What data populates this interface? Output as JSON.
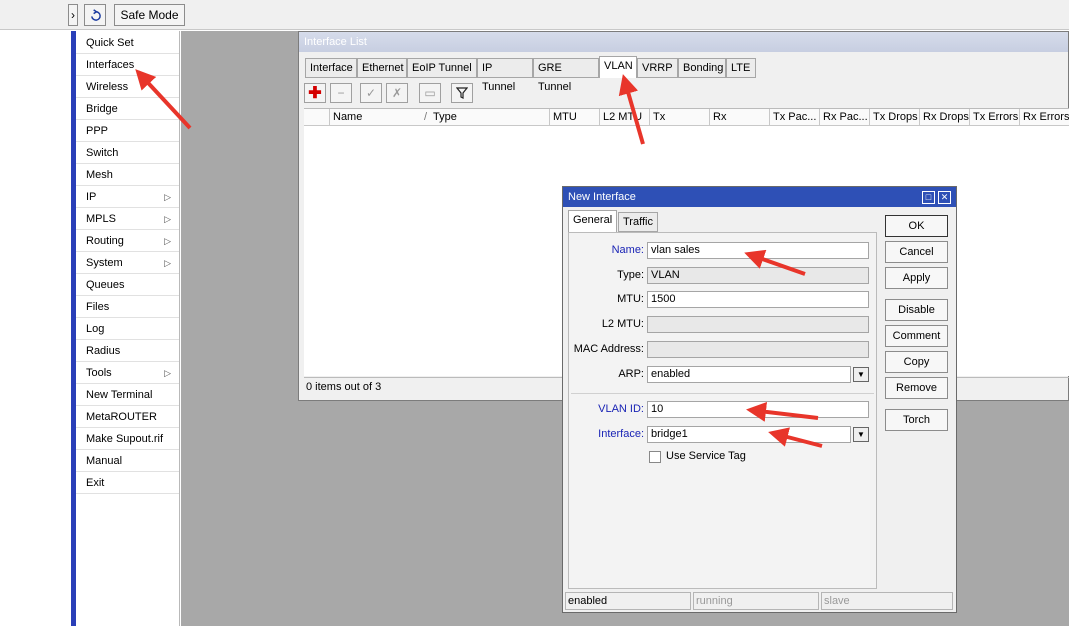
{
  "toolbar": {
    "redo_icon": "redo-icon",
    "safe_mode_label": "Safe Mode"
  },
  "sidebar": {
    "items": [
      {
        "label": "Quick Set",
        "submenu": false
      },
      {
        "label": "Interfaces",
        "submenu": false
      },
      {
        "label": "Wireless",
        "submenu": false
      },
      {
        "label": "Bridge",
        "submenu": false
      },
      {
        "label": "PPP",
        "submenu": false
      },
      {
        "label": "Switch",
        "submenu": false
      },
      {
        "label": "Mesh",
        "submenu": false
      },
      {
        "label": "IP",
        "submenu": true
      },
      {
        "label": "MPLS",
        "submenu": true
      },
      {
        "label": "Routing",
        "submenu": true
      },
      {
        "label": "System",
        "submenu": true
      },
      {
        "label": "Queues",
        "submenu": false
      },
      {
        "label": "Files",
        "submenu": false
      },
      {
        "label": "Log",
        "submenu": false
      },
      {
        "label": "Radius",
        "submenu": false
      },
      {
        "label": "Tools",
        "submenu": true
      },
      {
        "label": "New Terminal",
        "submenu": false
      },
      {
        "label": "MetaROUTER",
        "submenu": false
      },
      {
        "label": "Make Supout.rif",
        "submenu": false
      },
      {
        "label": "Manual",
        "submenu": false
      },
      {
        "label": "Exit",
        "submenu": false
      }
    ],
    "submenu_glyph": "▷"
  },
  "interface_list": {
    "title": "Interface List",
    "tabs": [
      "Interface",
      "Ethernet",
      "EoIP Tunnel",
      "IP Tunnel",
      "GRE Tunnel",
      "VLAN",
      "VRRP",
      "Bonding",
      "LTE"
    ],
    "active_tab": "VLAN",
    "columns": [
      "",
      "Name",
      "/",
      "Type",
      "MTU",
      "L2 MTU",
      "Tx",
      "Rx",
      "Tx Pac...",
      "Rx Pac...",
      "Tx Drops",
      "Rx Drops",
      "Tx Errors",
      "Rx Errors"
    ],
    "status": "0 items out of 3"
  },
  "dialog": {
    "title": "New Interface",
    "tabs": [
      "General",
      "Traffic"
    ],
    "fields": {
      "name": {
        "label": "Name:",
        "value": "vlan sales"
      },
      "type": {
        "label": "Type:",
        "value": "VLAN"
      },
      "mtu": {
        "label": "MTU:",
        "value": "1500"
      },
      "l2mtu": {
        "label": "L2 MTU:",
        "value": ""
      },
      "mac": {
        "label": "MAC Address:",
        "value": ""
      },
      "arp": {
        "label": "ARP:",
        "value": "enabled"
      },
      "vlan_id": {
        "label": "VLAN ID:",
        "value": "10"
      },
      "interface": {
        "label": "Interface:",
        "value": "bridge1"
      }
    },
    "service_tag_label": "Use Service Tag",
    "buttons": [
      "OK",
      "Cancel",
      "Apply",
      "Disable",
      "Comment",
      "Copy",
      "Remove",
      "Torch"
    ],
    "status": [
      "enabled",
      "running",
      "slave"
    ]
  },
  "colors": {
    "accent_blue": "#2e50b6",
    "arrow_red": "#e8352a",
    "workspace_gray": "#a8a8a8"
  }
}
